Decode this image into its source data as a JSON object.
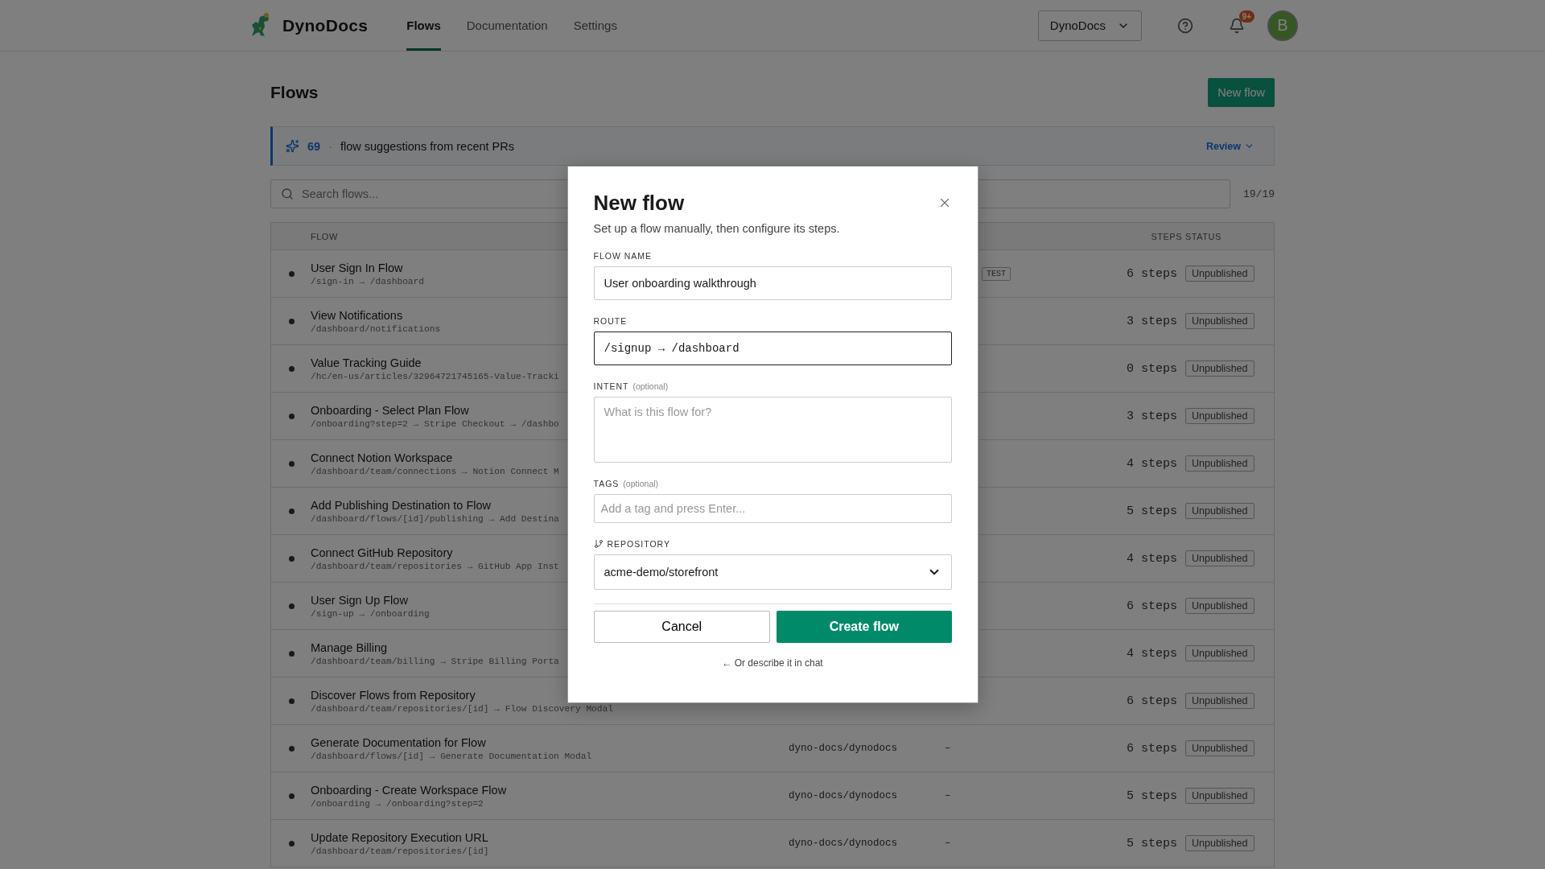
{
  "header": {
    "brand": "DynoDocs",
    "nav": [
      {
        "label": "Flows",
        "selected": true
      },
      {
        "label": "Documentation",
        "selected": false
      },
      {
        "label": "Settings",
        "selected": false
      }
    ],
    "workspace": "DynoDocs",
    "notification_badge": "9+",
    "avatar": "B"
  },
  "page": {
    "title": "Flows",
    "new_button": "New flow",
    "banner": {
      "count": "69",
      "separator": "·",
      "text": "flow suggestions from recent PRs",
      "action": "Review"
    },
    "search": {
      "placeholder": "Search flows..."
    },
    "count": "19/19",
    "table": {
      "columns": [
        {
          "label": "FLOW"
        },
        {
          "label": "STEPS"
        },
        {
          "label": "STATUS"
        }
      ],
      "rows": [
        {
          "title": "User Sign In Flow",
          "route": "/sign-in → /dashboard",
          "tag": "TEST",
          "steps": "6 steps",
          "status": "Unpublished"
        },
        {
          "title": "View Notifications",
          "route": "/dashboard/notifications",
          "steps": "3 steps",
          "status": "Unpublished"
        },
        {
          "title": "Value Tracking Guide",
          "route": "/hc/en-us/articles/32964721745165-Value-Tracki",
          "steps": "0 steps",
          "status": "Unpublished"
        },
        {
          "title": "Onboarding - Select Plan Flow",
          "route": "/onboarding?step=2 → Stripe Checkout → /dashbo",
          "steps": "3 steps",
          "status": "Unpublished"
        },
        {
          "title": "Connect Notion Workspace",
          "route": "/dashboard/team/connections → Notion Connect M",
          "steps": "4 steps",
          "status": "Unpublished"
        },
        {
          "title": "Add Publishing Destination to Flow",
          "route": "/dashboard/flows/[id]/publishing → Add Destina",
          "steps": "5 steps",
          "status": "Unpublished"
        },
        {
          "title": "Connect GitHub Repository",
          "route": "/dashboard/team/repositories → GitHub App Inst",
          "steps": "4 steps",
          "status": "Unpublished"
        },
        {
          "title": "User Sign Up Flow",
          "route": "/sign-up → /onboarding",
          "steps": "6 steps",
          "status": "Unpublished"
        },
        {
          "title": "Manage Billing",
          "route": "/dashboard/team/billing → Stripe Billing Porta",
          "steps": "4 steps",
          "status": "Unpublished"
        },
        {
          "title": "Discover Flows from Repository",
          "route": "/dashboard/team/repositories/[id] → Flow Discovery Modal",
          "steps": "6 steps",
          "status": "Unpublished"
        },
        {
          "title": "Generate Documentation for Flow",
          "route": "/dashboard/flows/[id] → Generate Documentation Modal",
          "repository": "dyno-docs/dynodocs",
          "column_4": "–",
          "steps": "6 steps",
          "status": "Unpublished"
        },
        {
          "title": "Onboarding - Create Workspace Flow",
          "route": "/onboarding → /onboarding?step=2",
          "repository": "dyno-docs/dynodocs",
          "column_4": "–",
          "steps": "5 steps",
          "status": "Unpublished"
        },
        {
          "title": "Update Repository Execution URL",
          "route": "/dashboard/team/repositories/[id]",
          "repository": "dyno-docs/dynodocs",
          "column_4": "–",
          "steps": "5 steps",
          "status": "Unpublished"
        }
      ]
    }
  },
  "modal": {
    "title": "New flow",
    "subtitle": "Set up a flow manually, then configure its steps.",
    "fields": [
      {
        "kind": "text",
        "label": "FLOW NAME",
        "value": "User onboarding walkthrough",
        "focused": false
      },
      {
        "kind": "code",
        "label": "ROUTE",
        "value": "/signup → /dashboard",
        "focused": true
      },
      {
        "kind": "textarea",
        "label": "INTENT",
        "hint": "(optional)",
        "placeholder": "What is this flow for?",
        "focused": false
      },
      {
        "kind": "tags",
        "label": "TAGS",
        "hint": "(optional)",
        "placeholder": "Add a tag and press Enter...",
        "focused": false
      },
      {
        "kind": "select",
        "label": "REPOSITORY",
        "value": "acme-demo/storefront",
        "focused": false
      }
    ],
    "cancel": "Cancel",
    "submit": "Create flow",
    "chat_link": "← Or describe it in chat"
  }
}
